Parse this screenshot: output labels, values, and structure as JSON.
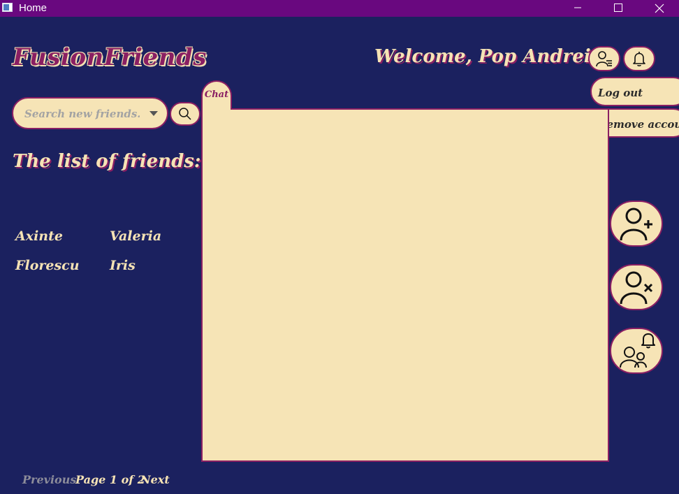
{
  "window": {
    "title": "Home"
  },
  "app": {
    "logo": "FusionFriends",
    "welcome": "Welcome, Pop Andrei!"
  },
  "user_menu": {
    "logout_label": "Log out",
    "remove_account_label": "Remove account"
  },
  "search": {
    "placeholder": "Search new friends..."
  },
  "friends": {
    "title": "The list of friends:",
    "names": [
      "Axinte",
      "Valeria",
      "Florescu",
      "Iris"
    ]
  },
  "chat": {
    "tab_label": "Chat"
  },
  "pagination": {
    "previous_label": "Previous",
    "page_info": "Page 1 of 2",
    "next_label": "Next"
  },
  "colors": {
    "background": "#1b215f",
    "titlebar": "#69087f",
    "panel": "#f6e4b6",
    "accent": "#8a1f63",
    "text_light": "#f6e3b5"
  }
}
